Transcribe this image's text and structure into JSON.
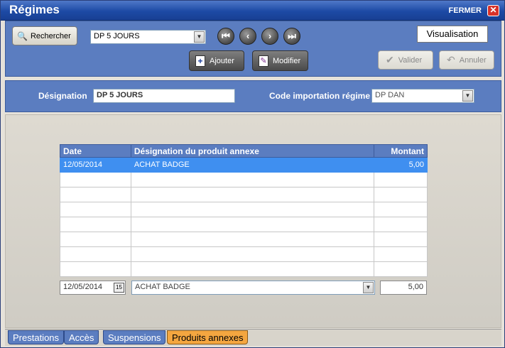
{
  "window": {
    "title": "Régimes",
    "close_label": "FERMER",
    "close_glyph": "✕"
  },
  "toolbar": {
    "search_label": "Rechercher",
    "regime_select_value": "DP 5 JOURS",
    "nav": [
      "⏮",
      "‹",
      "›",
      "⏭"
    ],
    "add_label": "Ajouter",
    "modify_label": "Modifier",
    "validate_label": "Valider",
    "cancel_label": "Annuler",
    "mode_label": "Visualisation"
  },
  "designation": {
    "label": "Désignation",
    "value": "DP 5 JOURS",
    "code_label": "Code importation régime",
    "code_value": "DP DAN"
  },
  "table": {
    "headers": {
      "date": "Date",
      "designation": "Désignation du produit annexe",
      "amount": "Montant"
    },
    "rows": [
      {
        "date": "12/05/2014",
        "designation": "ACHAT BADGE",
        "amount": "5,00"
      }
    ]
  },
  "edit_row": {
    "date": "12/05/2014",
    "calendar_label": "15",
    "designation": "ACHAT BADGE",
    "amount": "5,00"
  },
  "tabs": [
    "Prestations",
    "Accès",
    "Suspensions",
    "Produits annexes"
  ],
  "colors": {
    "panel": "#5b7dc0",
    "selected": "#3f8ff0",
    "active_tab": "#f4a640"
  }
}
